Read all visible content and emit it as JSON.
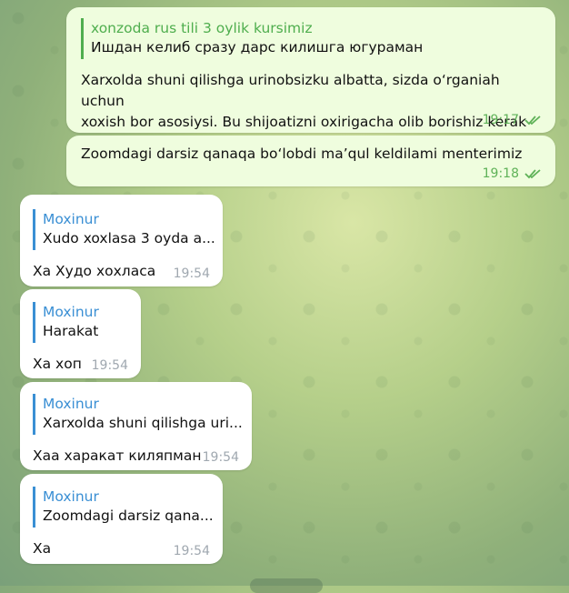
{
  "messages": [
    {
      "reply_author": "xonzoda rus tili 3 oylik kursimiz",
      "reply_text": "Ишдан келиб сразу дарс килишга югураман",
      "text_line1": "Xarxolda shuni qilishga urinobsizku albatta, sizda o‘rganiah uchun",
      "text_line2": "xoxish bor asosiysi. Bu shijoatizni oxirigacha olib borishiz kerak",
      "time": "19:17"
    },
    {
      "text": "Zoomdagi darsiz qanaqa bo‘lobdi ma’qul keldilami menterimiz",
      "time": "19:18"
    },
    {
      "reply_author": "Moxinur",
      "reply_text": "Xudo xoxlasa 3 oyda a...",
      "text": "Ха Худо хохласа",
      "time": "19:54"
    },
    {
      "reply_author": "Moxinur",
      "reply_text": "Harakat",
      "text": "Ха хоп",
      "time": "19:54"
    },
    {
      "reply_author": "Moxinur",
      "reply_text": "Xarxolda shuni qilishga uri...",
      "text": "Хаа харакат киляпман",
      "time": "19:54"
    },
    {
      "reply_author": "Moxinur",
      "reply_text": "Zoomdagi darsiz qana...",
      "text": "Ха",
      "time": "19:54"
    }
  ],
  "colors": {
    "outgoing_bubble": "#effdde",
    "incoming_bubble": "#ffffff",
    "outgoing_accent": "#4fae4e",
    "incoming_accent": "#3a8fd4"
  }
}
